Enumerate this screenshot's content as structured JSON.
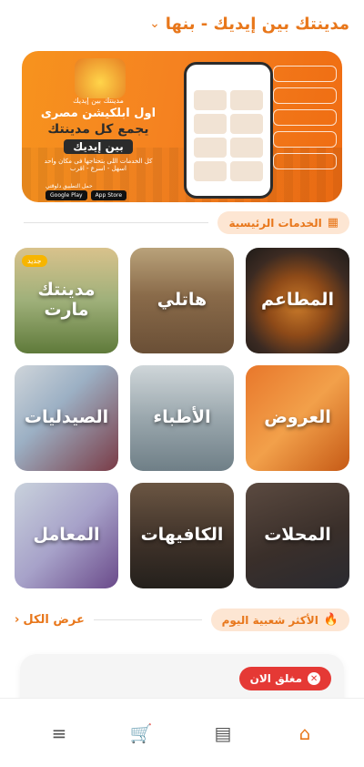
{
  "header": {
    "title": "مدينتك بين إيديك - بنها",
    "chevron_icon": "chevron-down-icon"
  },
  "banner": {
    "line1": "مدينتك بين إيديك",
    "line2": "اول ابلكيشن مصرى",
    "line3": "يجمع كل مدينتك",
    "line4": "بين إيديك",
    "line5": "كل الخدمات اللى بتحتاجها فى مكان واحد",
    "line6": "اسهل - اسرع - اقرب",
    "download": "حمل التطبيق دلوقتي",
    "google_play": "Google Play",
    "app_store": "App Store"
  },
  "main_services": {
    "label": "الخدمات الرئيسية",
    "icon": "grid-icon"
  },
  "tiles": [
    {
      "label": "المطاعم",
      "name": "restaurants"
    },
    {
      "label": "هاتلي",
      "name": "hatly"
    },
    {
      "label": "مدينتك مارت",
      "name": "madinetak-mart",
      "badge": "جديد"
    },
    {
      "label": "العروض",
      "name": "offers"
    },
    {
      "label": "الأطباء",
      "name": "doctors"
    },
    {
      "label": "الصيدليات",
      "name": "pharmacies"
    },
    {
      "label": "المحلات",
      "name": "shops"
    },
    {
      "label": "الكافيهات",
      "name": "cafes"
    },
    {
      "label": "المعامل",
      "name": "labs"
    }
  ],
  "popular": {
    "label": "الأكثر شعبية اليوم",
    "icon": "fire-icon",
    "see_all": "عرض الكل"
  },
  "status": {
    "closed": "مغلق الان"
  },
  "nav": {
    "icons": [
      "menu-icon",
      "cart-icon",
      "orders-icon",
      "home-icon"
    ]
  },
  "colors": {
    "accent": "#e8771b",
    "closed": "#e53935"
  }
}
